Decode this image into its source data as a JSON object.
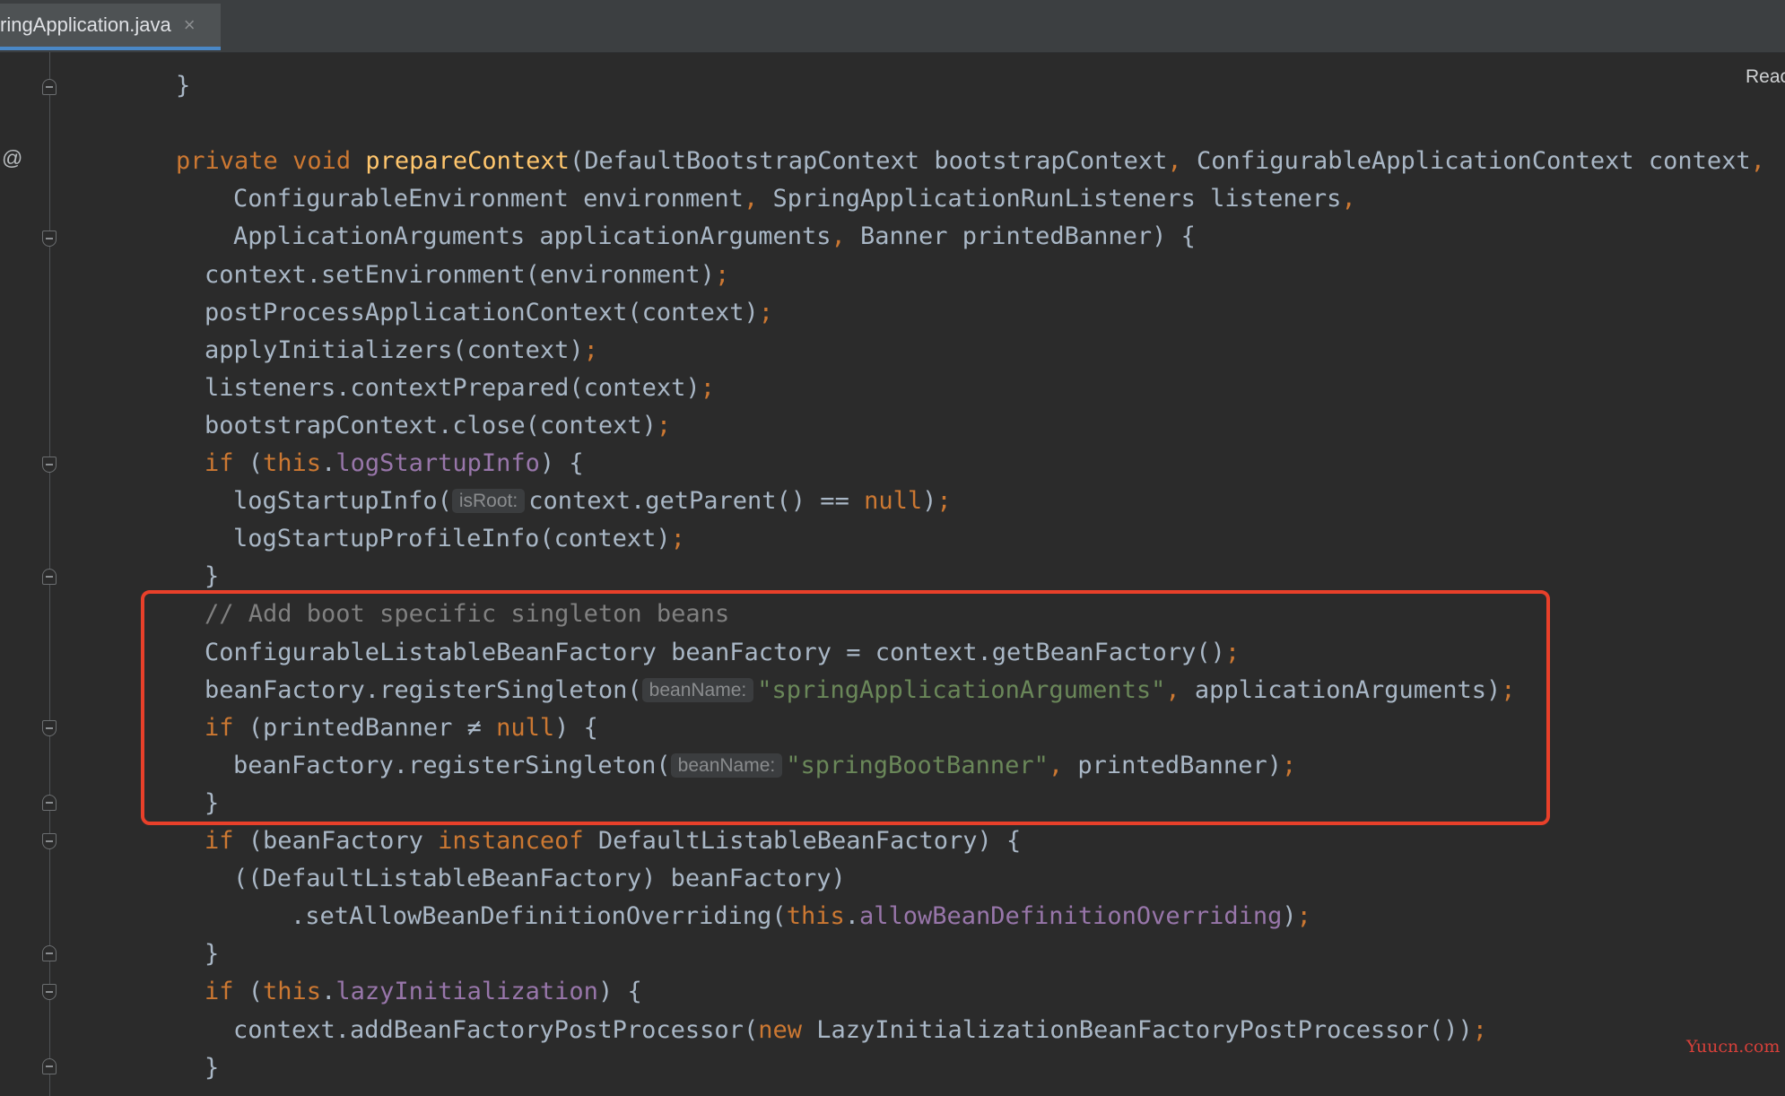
{
  "tab": {
    "label": "ringApplication.java",
    "close_glyph": "×",
    "close_icon": "close-icon"
  },
  "reader_mode": "Reac",
  "gutter": {
    "override_marker": "@"
  },
  "watermark": "Yuucn.com",
  "colors": {
    "background": "#2b2b2b",
    "text": "#a9b7c6",
    "keyword": "#cc7832",
    "method_declaration": "#ffc66d",
    "field": "#9876aa",
    "string": "#6a8759",
    "comment": "#808080",
    "highlight_box": "#e8402a",
    "tab_underline": "#4a88c7"
  },
  "lines": [
    {
      "indent": 2,
      "tokens": [
        [
          "plain",
          "}"
        ]
      ]
    },
    {
      "indent": 0,
      "tokens": []
    },
    {
      "indent": 2,
      "tokens": [
        [
          "keyword",
          "private"
        ],
        [
          "plain",
          " "
        ],
        [
          "keyword",
          "void"
        ],
        [
          "plain",
          " "
        ],
        [
          "method-decl",
          "prepareContext"
        ],
        [
          "plain",
          "(DefaultBootstrapContext bootstrapContext"
        ],
        [
          "punct",
          ","
        ],
        [
          "plain",
          " ConfigurableApplicationContext context"
        ],
        [
          "punct",
          ","
        ]
      ]
    },
    {
      "indent": 4,
      "tokens": [
        [
          "plain",
          "ConfigurableEnvironment environment"
        ],
        [
          "punct",
          ","
        ],
        [
          "plain",
          " SpringApplicationRunListeners listeners"
        ],
        [
          "punct",
          ","
        ]
      ]
    },
    {
      "indent": 4,
      "tokens": [
        [
          "plain",
          "ApplicationArguments applicationArguments"
        ],
        [
          "punct",
          ","
        ],
        [
          "plain",
          " Banner printedBanner) {"
        ]
      ]
    },
    {
      "indent": 3,
      "tokens": [
        [
          "plain",
          "context.setEnvironment(environment)"
        ],
        [
          "punct",
          ";"
        ]
      ]
    },
    {
      "indent": 3,
      "tokens": [
        [
          "plain",
          "postProcessApplicationContext(context)"
        ],
        [
          "punct",
          ";"
        ]
      ]
    },
    {
      "indent": 3,
      "tokens": [
        [
          "plain",
          "applyInitializers(context)"
        ],
        [
          "punct",
          ";"
        ]
      ]
    },
    {
      "indent": 3,
      "tokens": [
        [
          "plain",
          "listeners.contextPrepared(context)"
        ],
        [
          "punct",
          ";"
        ]
      ]
    },
    {
      "indent": 3,
      "tokens": [
        [
          "plain",
          "bootstrapContext.close(context)"
        ],
        [
          "punct",
          ";"
        ]
      ]
    },
    {
      "indent": 3,
      "tokens": [
        [
          "keyword",
          "if"
        ],
        [
          "plain",
          " ("
        ],
        [
          "keyword",
          "this"
        ],
        [
          "plain",
          "."
        ],
        [
          "field",
          "logStartupInfo"
        ],
        [
          "plain",
          ") {"
        ]
      ]
    },
    {
      "indent": 4,
      "tokens": [
        [
          "plain",
          "logStartupInfo("
        ],
        [
          "hint",
          "isRoot:"
        ],
        [
          "plain",
          "context.getParent() == "
        ],
        [
          "keyword",
          "null"
        ],
        [
          "plain",
          ")"
        ],
        [
          "punct",
          ";"
        ]
      ]
    },
    {
      "indent": 4,
      "tokens": [
        [
          "plain",
          "logStartupProfileInfo(context)"
        ],
        [
          "punct",
          ";"
        ]
      ]
    },
    {
      "indent": 3,
      "tokens": [
        [
          "plain",
          "}"
        ]
      ]
    },
    {
      "indent": 3,
      "tokens": [
        [
          "comment",
          "// Add boot specific singleton beans"
        ]
      ]
    },
    {
      "indent": 3,
      "tokens": [
        [
          "plain",
          "ConfigurableListableBeanFactory beanFactory = context.getBeanFactory()"
        ],
        [
          "punct",
          ";"
        ]
      ]
    },
    {
      "indent": 3,
      "tokens": [
        [
          "plain",
          "beanFactory.registerSingleton("
        ],
        [
          "hint",
          "beanName:"
        ],
        [
          "string",
          "\"springApplicationArguments\""
        ],
        [
          "punct",
          ","
        ],
        [
          "plain",
          " applicationArguments)"
        ],
        [
          "punct",
          ";"
        ]
      ]
    },
    {
      "indent": 3,
      "tokens": [
        [
          "keyword",
          "if"
        ],
        [
          "plain",
          " (printedBanner ≠ "
        ],
        [
          "keyword",
          "null"
        ],
        [
          "plain",
          ") {"
        ]
      ]
    },
    {
      "indent": 4,
      "tokens": [
        [
          "plain",
          "beanFactory.registerSingleton("
        ],
        [
          "hint",
          "beanName:"
        ],
        [
          "string",
          "\"springBootBanner\""
        ],
        [
          "punct",
          ","
        ],
        [
          "plain",
          " printedBanner)"
        ],
        [
          "punct",
          ";"
        ]
      ]
    },
    {
      "indent": 3,
      "tokens": [
        [
          "plain",
          "}"
        ]
      ]
    },
    {
      "indent": 3,
      "tokens": [
        [
          "keyword",
          "if"
        ],
        [
          "plain",
          " (beanFactory "
        ],
        [
          "keyword",
          "instanceof"
        ],
        [
          "plain",
          " DefaultListableBeanFactory) {"
        ]
      ]
    },
    {
      "indent": 4,
      "tokens": [
        [
          "plain",
          "((DefaultListableBeanFactory) beanFactory)"
        ]
      ]
    },
    {
      "indent": 6,
      "tokens": [
        [
          "plain",
          ".setAllowBeanDefinitionOverriding("
        ],
        [
          "keyword",
          "this"
        ],
        [
          "plain",
          "."
        ],
        [
          "field",
          "allowBeanDefinitionOverriding"
        ],
        [
          "plain",
          ")"
        ],
        [
          "punct",
          ";"
        ]
      ]
    },
    {
      "indent": 3,
      "tokens": [
        [
          "plain",
          "}"
        ]
      ]
    },
    {
      "indent": 3,
      "tokens": [
        [
          "keyword",
          "if"
        ],
        [
          "plain",
          " ("
        ],
        [
          "keyword",
          "this"
        ],
        [
          "plain",
          "."
        ],
        [
          "field",
          "lazyInitialization"
        ],
        [
          "plain",
          ") {"
        ]
      ]
    },
    {
      "indent": 4,
      "tokens": [
        [
          "plain",
          "context.addBeanFactoryPostProcessor("
        ],
        [
          "keyword",
          "new"
        ],
        [
          "plain",
          " LazyInitializationBeanFactoryPostProcessor())"
        ],
        [
          "punct",
          ";"
        ]
      ]
    },
    {
      "indent": 3,
      "tokens": [
        [
          "plain",
          "}"
        ]
      ]
    }
  ]
}
